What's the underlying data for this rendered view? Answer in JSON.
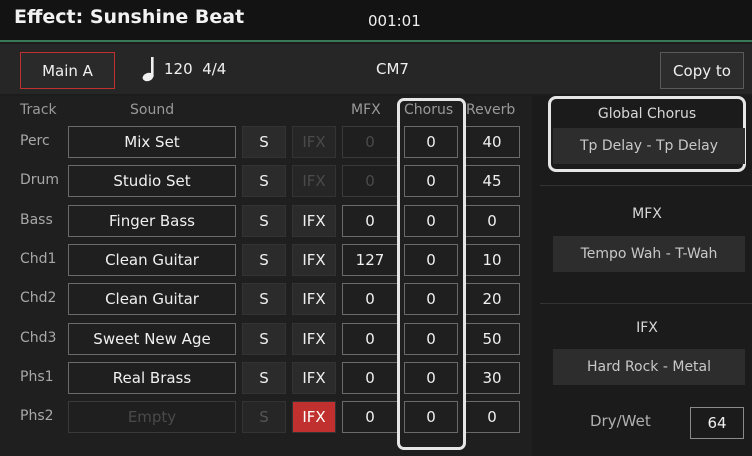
{
  "header": {
    "title": "Effect: Sunshine Beat",
    "timecode": "001:01"
  },
  "info": {
    "section": "Main A",
    "tempo": "120",
    "time_signature": "4/4",
    "chord": "CM7",
    "copy_to": "Copy to"
  },
  "columns": {
    "track": "Track",
    "sound": "Sound",
    "mfx": "MFX",
    "chorus": "Chorus",
    "reverb": "Reverb"
  },
  "tracks": [
    {
      "name": "Perc",
      "sound": "Mix Set",
      "s": "S",
      "ifx": "IFX",
      "mfx": "0",
      "chorus": "0",
      "reverb": "40",
      "ifx_state": "disabled",
      "mfx_disabled": true,
      "sound_disabled": false
    },
    {
      "name": "Drum",
      "sound": "Studio Set",
      "s": "S",
      "ifx": "IFX",
      "mfx": "0",
      "chorus": "0",
      "reverb": "45",
      "ifx_state": "disabled",
      "mfx_disabled": true,
      "sound_disabled": false
    },
    {
      "name": "Bass",
      "sound": "Finger Bass",
      "s": "S",
      "ifx": "IFX",
      "mfx": "0",
      "chorus": "0",
      "reverb": "0",
      "ifx_state": "normal",
      "mfx_disabled": false,
      "sound_disabled": false
    },
    {
      "name": "Chd1",
      "sound": "Clean Guitar",
      "s": "S",
      "ifx": "IFX",
      "mfx": "127",
      "chorus": "0",
      "reverb": "10",
      "ifx_state": "normal",
      "mfx_disabled": false,
      "sound_disabled": false
    },
    {
      "name": "Chd2",
      "sound": "Clean Guitar",
      "s": "S",
      "ifx": "IFX",
      "mfx": "0",
      "chorus": "0",
      "reverb": "20",
      "ifx_state": "normal",
      "mfx_disabled": false,
      "sound_disabled": false
    },
    {
      "name": "Chd3",
      "sound": "Sweet New Age",
      "s": "S",
      "ifx": "IFX",
      "mfx": "0",
      "chorus": "0",
      "reverb": "50",
      "ifx_state": "normal",
      "mfx_disabled": false,
      "sound_disabled": false
    },
    {
      "name": "Phs1",
      "sound": "Real Brass",
      "s": "S",
      "ifx": "IFX",
      "mfx": "0",
      "chorus": "0",
      "reverb": "30",
      "ifx_state": "normal",
      "mfx_disabled": false,
      "sound_disabled": false
    },
    {
      "name": "Phs2",
      "sound": "Empty",
      "s": "S",
      "ifx": "IFX",
      "mfx": "0",
      "chorus": "0",
      "reverb": "0",
      "ifx_state": "active",
      "mfx_disabled": false,
      "sound_disabled": true
    }
  ],
  "right_panel": {
    "global_chorus_label": "Global Chorus",
    "global_chorus_value": "Tp Delay - Tp Delay",
    "mfx_label": "MFX",
    "mfx_value": "Tempo Wah - T-Wah",
    "ifx_label": "IFX",
    "ifx_value": "Hard Rock - Metal",
    "drywet_label": "Dry/Wet",
    "drywet_value": "64"
  },
  "colors": {
    "accent_green": "#3a7a58",
    "active_red": "#c0302e",
    "highlight": "#e6e6e6"
  },
  "icons": {
    "tempo_icon": "quarter-note-icon"
  }
}
